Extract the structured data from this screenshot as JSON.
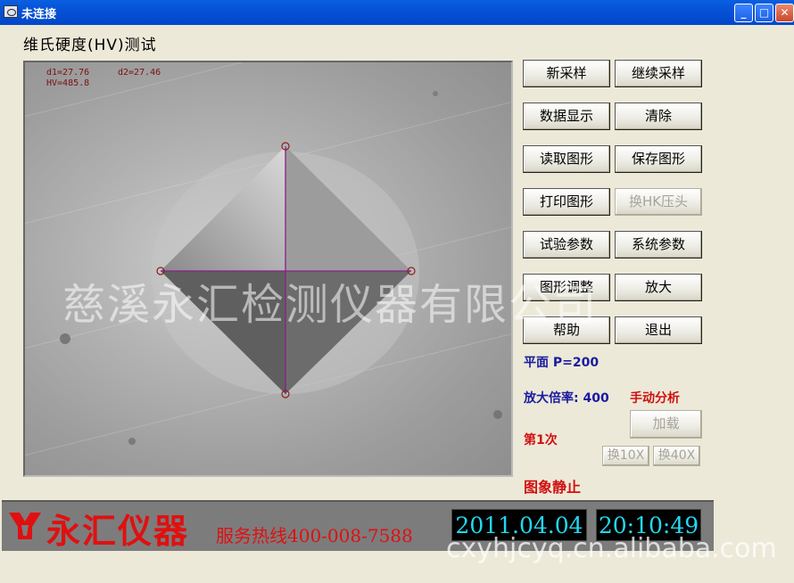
{
  "window": {
    "title": "未连接"
  },
  "heading": "维氏硬度(HV)测试",
  "measurements": {
    "d1": "d1=27.76",
    "d2": "d2=27.46",
    "hv": "HV=485.8"
  },
  "buttons": {
    "new_sample": "新采样",
    "continue_sample": "继续采样",
    "data_display": "数据显示",
    "clear": "清除",
    "read_image": "读取图形",
    "save_image": "保存图形",
    "print_image": "打印图形",
    "switch_hk": "换HK压头",
    "test_params": "试验参数",
    "system_params": "系统参数",
    "image_adjust": "图形调整",
    "zoom": "放大",
    "help": "帮助",
    "exit": "退出",
    "load": "加载",
    "switch_10x": "换10X",
    "switch_40x": "换40X"
  },
  "status": {
    "plane": "平面 P=200",
    "magnification": "放大倍率: 400",
    "analysis_mode": "手动分析",
    "count": "第1次",
    "image_state": "图象静止"
  },
  "footer": {
    "brand": "永汇仪器",
    "hotline": "服务热线400-008-7588",
    "date": "2011.04.04",
    "time": "20:10:49"
  },
  "watermarks": {
    "company": "慈溪永汇检测仪器有限公司",
    "url": "cxyhjcyq.cn.alibaba.com"
  },
  "colors": {
    "titlebar": "#0a5fe0",
    "measure_line": "#8a1f8a",
    "clock_text": "#22d8f0",
    "brand_red": "#e01010"
  }
}
